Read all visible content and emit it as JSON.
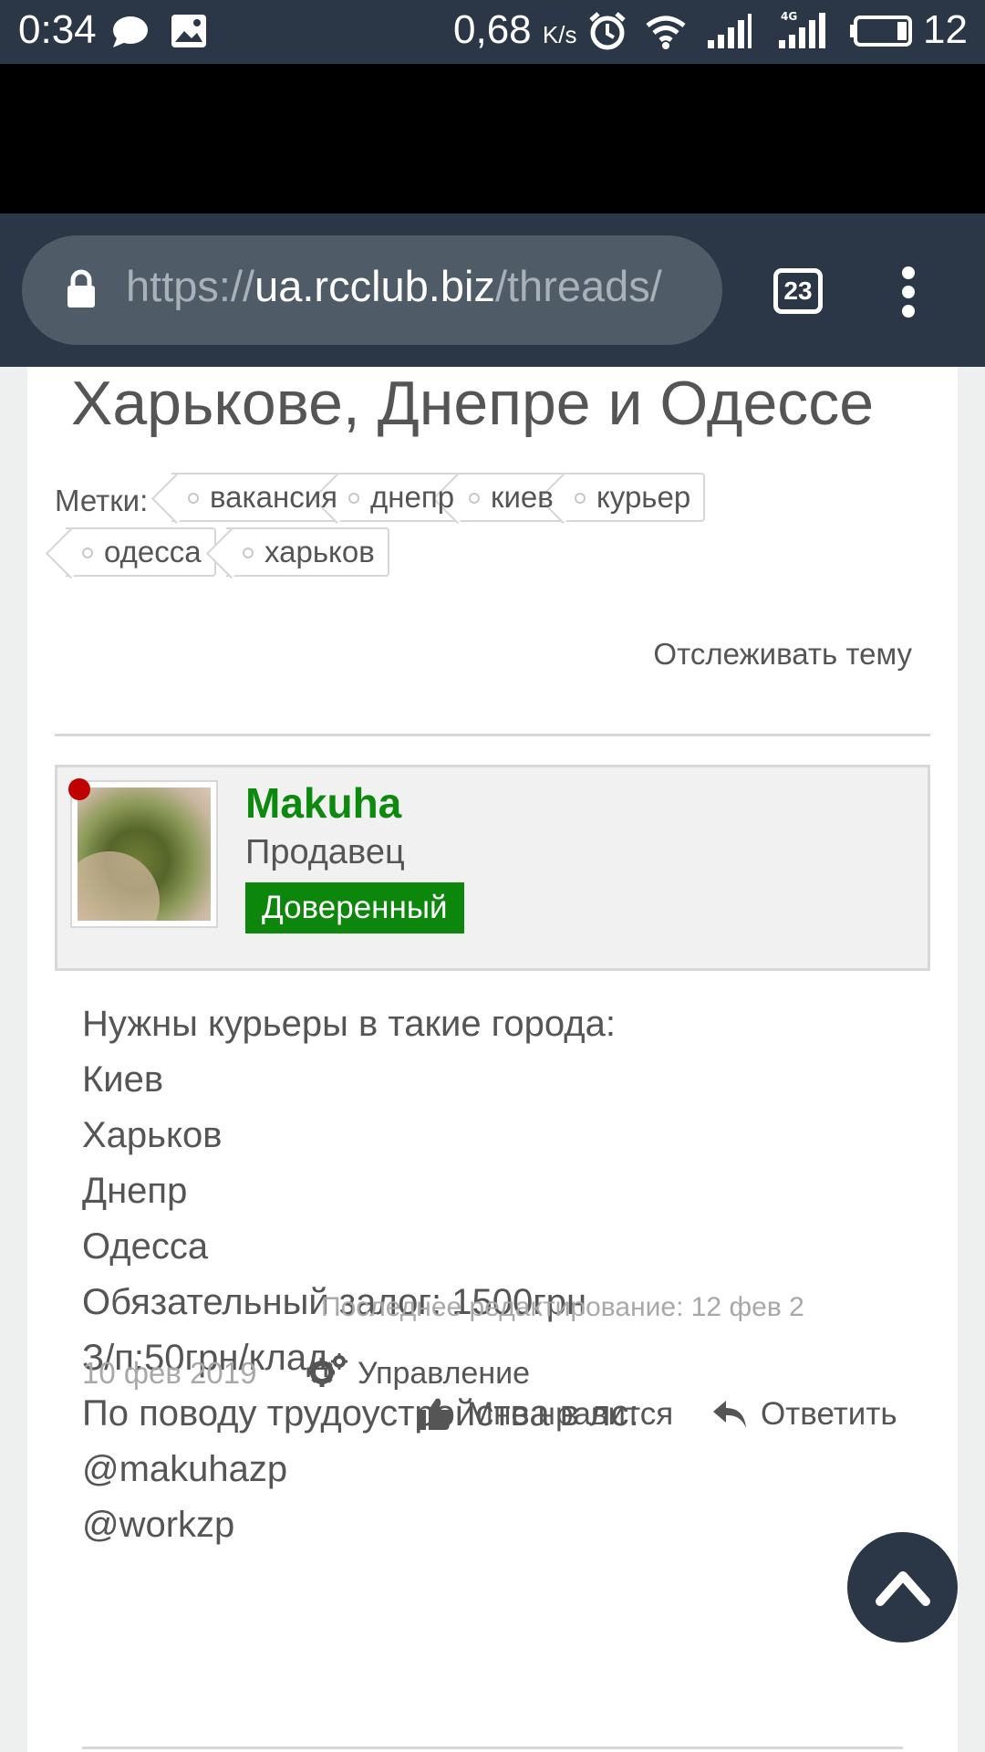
{
  "status_bar": {
    "time": "0:34",
    "speed_value": "0,68",
    "speed_unit": "K/s",
    "battery_level": "12",
    "tab_count": "23"
  },
  "browser": {
    "url_scheme": "https://",
    "url_host": "ua.rcclub.biz",
    "url_path": "/threads/"
  },
  "thread": {
    "title_fragment": "Харькове, Днепре и Одессе",
    "tags_label": "Метки:",
    "tags": [
      "вакансия",
      "днепр",
      "киев",
      "курьер",
      "одесса",
      "харьков"
    ],
    "follow_label": "Отслеживать тему"
  },
  "author": {
    "name": "Makuha",
    "role": "Продавец",
    "badge": "Доверенный"
  },
  "post": {
    "lines": [
      "Нужны курьеры в такие города:",
      "Киев",
      "Харьков",
      "Днепр",
      "Одесса",
      "Обязательный залог: 1500грн",
      "З/п:50грн/клад",
      "По поводу трудоустройства в лс:",
      "@makuhazp",
      "@workzp"
    ],
    "edited_note": "Последнее редактирование: 12 фев 2",
    "date": "10 фев 2019",
    "manage_label": "Управление",
    "like_label": "Мне нравится",
    "reply_label": "Ответить"
  },
  "colors": {
    "bar_bg": "#2b3746",
    "accent_green": "#0c870c",
    "online_red": "#c00000"
  }
}
